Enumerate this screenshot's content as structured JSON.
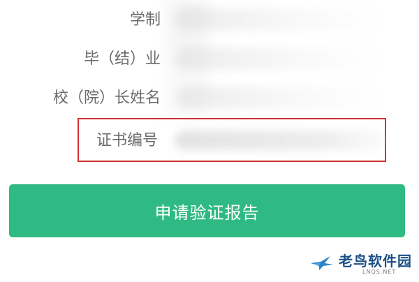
{
  "form": {
    "rows": [
      {
        "label": "学制"
      },
      {
        "label": "毕（结）业"
      },
      {
        "label": "校（院）长姓名"
      }
    ],
    "highlighted_row": {
      "label": "证书编号"
    }
  },
  "submit": {
    "label": "申请验证报告"
  },
  "brand": {
    "name": "老鸟软件园",
    "domain": "LNQS.NET",
    "colors": {
      "name": "#1b4f86",
      "bird": "#2a86c8"
    }
  },
  "colors": {
    "primary_button": "#2fba83",
    "highlight_border": "#d32f2f",
    "label_text": "#6b6b6b"
  }
}
